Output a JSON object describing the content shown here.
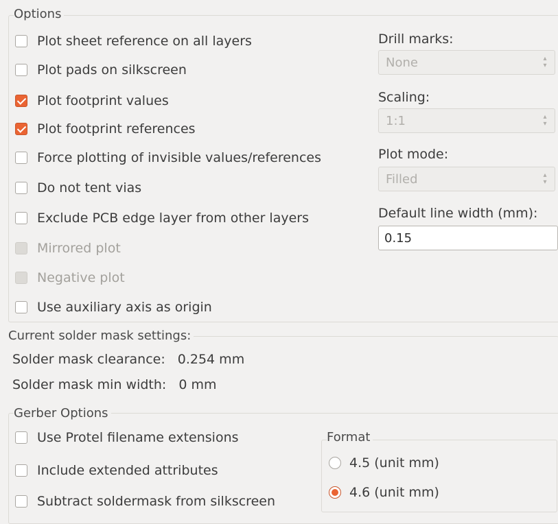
{
  "options": {
    "legend": "Options",
    "checkboxes": [
      {
        "label": "Plot sheet reference on all layers",
        "checked": false,
        "enabled": true
      },
      {
        "label": "Plot pads on silkscreen",
        "checked": false,
        "enabled": true
      },
      {
        "label": "Plot footprint values",
        "checked": true,
        "enabled": true
      },
      {
        "label": "Plot footprint references",
        "checked": true,
        "enabled": true
      },
      {
        "label": "Force plotting of invisible values/references",
        "checked": false,
        "enabled": true
      },
      {
        "label": "Do not tent vias",
        "checked": false,
        "enabled": true
      },
      {
        "label": "Exclude PCB edge layer from other layers",
        "checked": false,
        "enabled": true
      },
      {
        "label": "Mirrored plot",
        "checked": false,
        "enabled": false
      },
      {
        "label": "Negative plot",
        "checked": false,
        "enabled": false
      },
      {
        "label": "Use auxiliary axis as origin",
        "checked": false,
        "enabled": true
      }
    ],
    "drill_marks": {
      "label": "Drill marks:",
      "value": "None"
    },
    "scaling": {
      "label": "Scaling:",
      "value": "1:1"
    },
    "plot_mode": {
      "label": "Plot mode:",
      "value": "Filled"
    },
    "line_width": {
      "label": "Default line width (mm):",
      "value": "0.15"
    }
  },
  "solder_mask": {
    "legend": "Current solder mask settings:",
    "clearance_label": "Solder mask clearance:",
    "clearance_value": "0.254 mm",
    "min_width_label": "Solder mask min width:",
    "min_width_value": "0 mm"
  },
  "gerber": {
    "legend": "Gerber Options",
    "checkboxes": [
      {
        "label": "Use Protel filename extensions",
        "checked": false
      },
      {
        "label": "Include extended attributes",
        "checked": false
      },
      {
        "label": "Subtract soldermask from silkscreen",
        "checked": false
      }
    ],
    "format": {
      "legend": "Format",
      "options": [
        {
          "label": "4.5 (unit mm)",
          "selected": false
        },
        {
          "label": "4.6 (unit mm)",
          "selected": true
        }
      ]
    }
  },
  "colors": {
    "accent": "#ea6433",
    "window_bg": "#f2f1f0"
  }
}
